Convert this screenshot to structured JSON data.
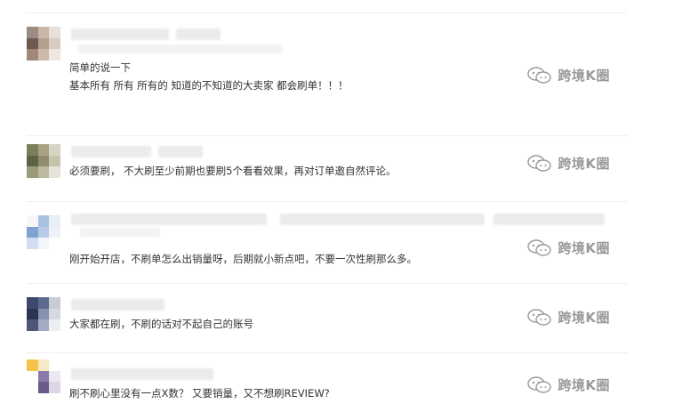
{
  "watermark": "跨境K圈",
  "comments": [
    {
      "lines": [
        "简单的说一下",
        "基本所有 所有 所有的 知道的不知道的大卖家  都会刷单！！！"
      ],
      "avatar_colors": [
        "#9a8c82",
        "#c8b7a8",
        "#e8e0d8",
        "#6e5a4f",
        "#b59f8f",
        "#d8ccc1",
        "#a48877",
        "#cdb9a9",
        "#eee8e2"
      ]
    },
    {
      "lines": [
        "必须要刷，  不大刷至少前期也要刷5个看看效果，再对订单邀自然评论。"
      ],
      "avatar_colors": [
        "#7b7e5a",
        "#a7a283",
        "#d8d4c4",
        "#5f6147",
        "#8f8d6d",
        "#c7c2ab",
        "#9a9b7b",
        "#bdb8a0",
        "#e6e3d8"
      ]
    },
    {
      "lines": [
        "刚开始开店，不刷单怎么出销量呀，后期就小新点吧，不要一次性刷那么多。"
      ],
      "avatar_colors": [
        "#f4f6fa",
        "#a9c1e0",
        "#e8eef6",
        "#7fa3d1",
        "#b7cbe5",
        "#eef2f8",
        "#d3dff0",
        "#f2f5fa",
        "#ffffff"
      ]
    },
    {
      "lines": [
        "大家都在刷，不刷的话对不起自己的账号"
      ],
      "avatar_colors": [
        "#3d4a6b",
        "#5a6a90",
        "#c9ccd6",
        "#2c3550",
        "#8592b0",
        "#d7d9e0",
        "#4c5778",
        "#a3abc2",
        "#eceef2"
      ]
    },
    {
      "lines": [
        "刷不刷心里没有一点X数？ 又要销量，又不想刷REVIEW?"
      ],
      "avatar_colors": [
        "#f6c24a",
        "#f8e9c6",
        "#ffffff",
        "#ffffff",
        "#8b7aa8",
        "#ece8f2",
        "#ffffff",
        "#6b5a8c",
        "#dcd6e6"
      ]
    }
  ]
}
